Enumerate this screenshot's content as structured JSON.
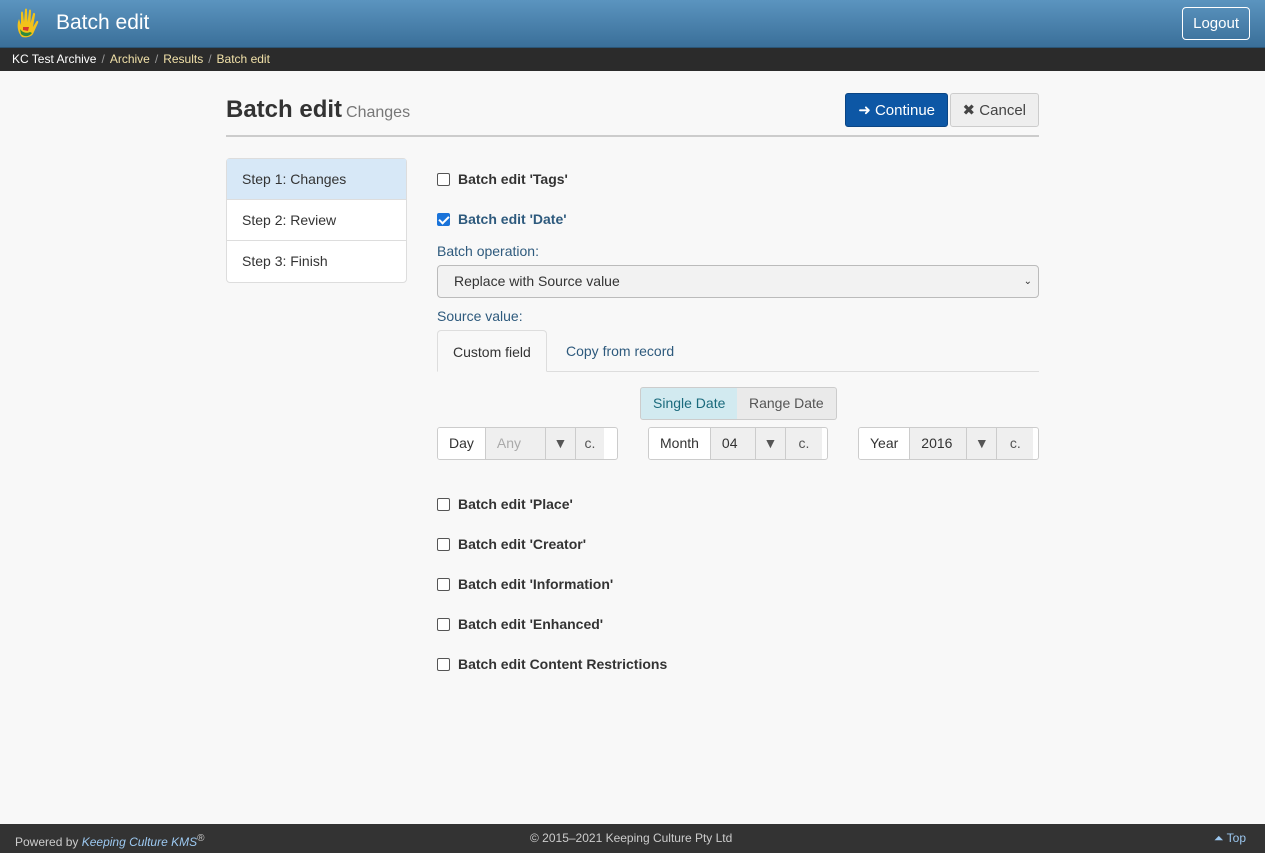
{
  "header": {
    "title": "Batch edit",
    "logout_label": "Logout"
  },
  "breadcrumb": [
    "KC Test Archive",
    "Archive",
    "Results",
    "Batch edit"
  ],
  "page": {
    "title": "Batch edit",
    "subtitle": "Changes",
    "continue_label": "Continue",
    "cancel_label": "Cancel"
  },
  "steps": [
    {
      "label": "Step 1: Changes",
      "active": true
    },
    {
      "label": "Step 2: Review",
      "active": false
    },
    {
      "label": "Step 3: Finish",
      "active": false
    }
  ],
  "fields": {
    "tags": {
      "label": "Batch edit 'Tags'",
      "checked": false
    },
    "date": {
      "label": "Batch edit 'Date'",
      "checked": true
    },
    "place": {
      "label": "Batch edit 'Place'",
      "checked": false
    },
    "creator": {
      "label": "Batch edit 'Creator'",
      "checked": false
    },
    "information": {
      "label": "Batch edit 'Information'",
      "checked": false
    },
    "enhanced": {
      "label": "Batch edit 'Enhanced'",
      "checked": false
    },
    "restrictions": {
      "label": "Batch edit Content Restrictions",
      "checked": false
    }
  },
  "operation": {
    "label": "Batch operation:",
    "value": "Replace with Source value"
  },
  "source": {
    "label": "Source value:",
    "tabs": [
      "Custom field",
      "Copy from record"
    ]
  },
  "date_mode": {
    "single": "Single Date",
    "range": "Range Date"
  },
  "date": {
    "day": {
      "label": "Day",
      "value": "Any",
      "circa": "c."
    },
    "month": {
      "label": "Month",
      "value": "04",
      "circa": "c."
    },
    "year": {
      "label": "Year",
      "value": "2016",
      "circa": "c."
    }
  },
  "footer": {
    "powered_prefix": "Powered by",
    "powered_brand": "Keeping Culture KMS",
    "registered": "®",
    "copyright": "© 2015–2021 Keeping Culture Pty Ltd",
    "top_label": "Top"
  },
  "colors": {
    "primary": "#0d57a5",
    "header": "#4a83ae",
    "active_step": "#d7e8f7"
  }
}
